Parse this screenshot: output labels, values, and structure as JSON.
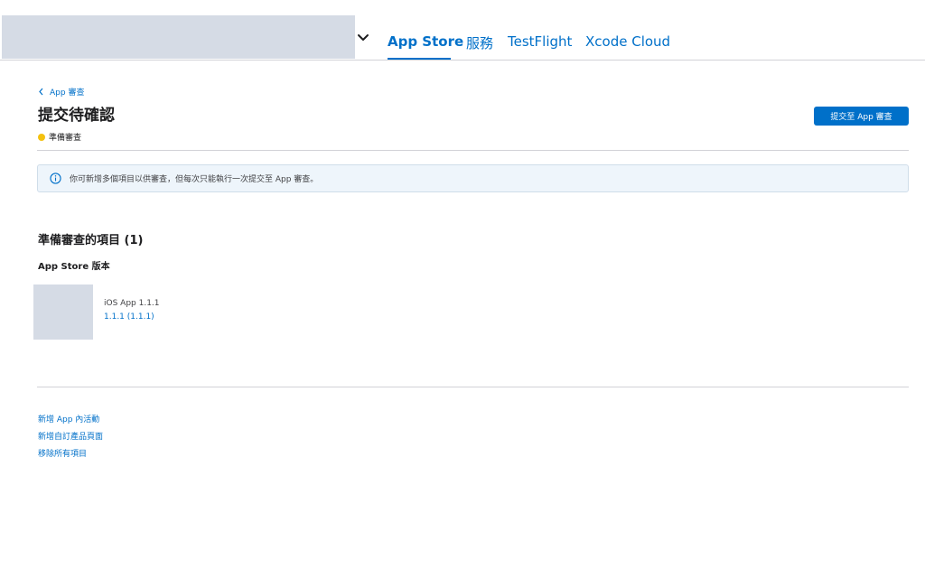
{
  "nav": {
    "tabs": [
      {
        "label": "App Store",
        "active": true
      },
      {
        "label": "服務"
      },
      {
        "label": "TestFlight"
      },
      {
        "label": "Xcode Cloud"
      }
    ],
    "dropdown_icon": "chevron-down-icon"
  },
  "header": {
    "breadcrumb": "App 審查",
    "title": "提交待確認",
    "status": "準備審查",
    "status_color": "#f4c10f",
    "submit_label": "提交至 App 審查"
  },
  "info_banner": {
    "icon": "info-icon",
    "text": "你可新增多個項目以供審查，但每次只能執行一次提交至 App 審查。"
  },
  "items_section": {
    "title": "準備審查的項目 (1)",
    "subtitle": "App Store 版本",
    "items": [
      {
        "name": "iOS App 1.1.1",
        "build": "1.1.1 (1.1.1)"
      }
    ]
  },
  "footer_links": [
    "新增 App 內活動",
    "新增自訂產品頁面",
    "移除所有項目"
  ],
  "colors": {
    "accent": "#0070c9",
    "placeholder": "#d5dbe5"
  }
}
